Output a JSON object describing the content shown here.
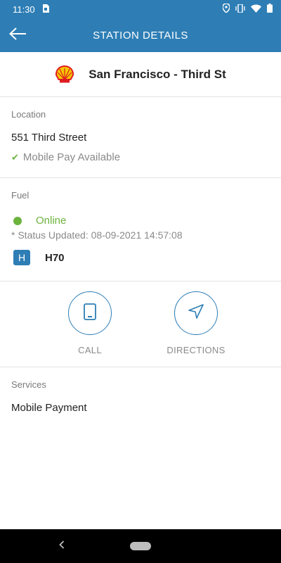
{
  "status_bar": {
    "time": "11:30",
    "icons": [
      "sim-icon",
      "location-icon",
      "vibrate-icon",
      "wifi-icon",
      "battery-icon"
    ]
  },
  "app_bar": {
    "title": "STATION DETAILS",
    "back_icon": "arrow-left-icon"
  },
  "station": {
    "brand_logo": "shell-logo",
    "name": "San Francisco - Third St"
  },
  "location": {
    "label": "Location",
    "address": "551 Third Street",
    "mobile_pay_text": "Mobile Pay Available"
  },
  "fuel": {
    "label": "Fuel",
    "status": "Online",
    "status_updated": "* Status Updated: 08-09-2021 14:57:08",
    "items": [
      {
        "badge": "H",
        "name": "H70"
      }
    ]
  },
  "actions": {
    "call_label": "CALL",
    "directions_label": "DIRECTIONS"
  },
  "services": {
    "label": "Services",
    "items": [
      "Mobile Payment"
    ]
  },
  "colors": {
    "primary": "#2e7eb5",
    "online_green": "#6cb33e",
    "muted_text": "#8a8a8a"
  }
}
